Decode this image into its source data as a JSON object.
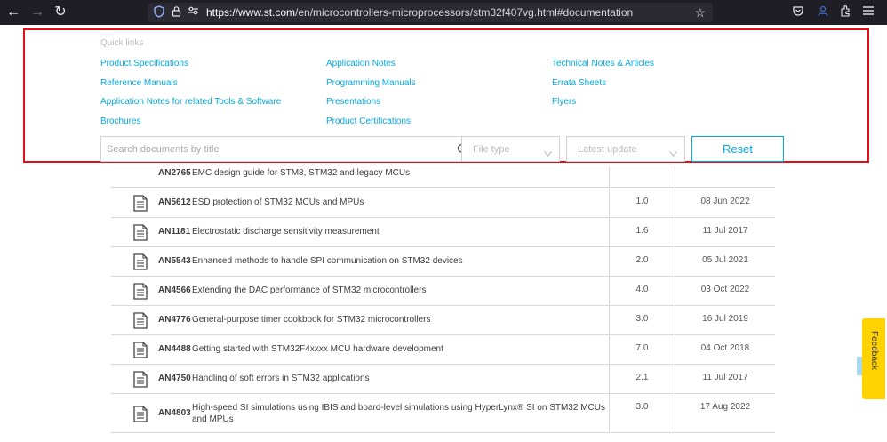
{
  "browser": {
    "url_host": "https://www.st.com",
    "url_path": "/en/microcontrollers-microprocessors/stm32f407vg.html#documentation"
  },
  "quick_links": {
    "heading": "Quick links",
    "col1": [
      "Product Specifications",
      "Reference Manuals",
      "Application Notes for related Tools & Software",
      "Brochures"
    ],
    "col2": [
      "Application Notes",
      "Programming Manuals",
      "Presentations",
      "Product Certifications"
    ],
    "col3": [
      "Technical Notes & Articles",
      "Errata Sheets",
      "Flyers"
    ]
  },
  "filters": {
    "search_placeholder": "Search documents by title",
    "file_type": "File type",
    "latest_update": "Latest update",
    "reset_label": "Reset"
  },
  "partial_row": {
    "code": "AN2765",
    "title": "EMC design guide for STM8, STM32 and legacy MCUs"
  },
  "documents": [
    {
      "code": "AN5612",
      "title": "ESD protection of STM32 MCUs and MPUs",
      "version": "1.0",
      "date": "08 Jun 2022"
    },
    {
      "code": "AN1181",
      "title": "Electrostatic discharge sensitivity measurement",
      "version": "1.6",
      "date": "11 Jul 2017"
    },
    {
      "code": "AN5543",
      "title": "Enhanced methods to handle SPI communication on STM32 devices",
      "version": "2.0",
      "date": "05 Jul 2021"
    },
    {
      "code": "AN4566",
      "title": "Extending the DAC performance of STM32 microcontrollers",
      "version": "4.0",
      "date": "03 Oct 2022"
    },
    {
      "code": "AN4776",
      "title": "General-purpose timer cookbook for STM32 microcontrollers",
      "version": "3.0",
      "date": "16 Jul 2019"
    },
    {
      "code": "AN4488",
      "title": "Getting started with STM32F4xxxx MCU hardware development",
      "version": "7.0",
      "date": "04 Oct 2018"
    },
    {
      "code": "AN4750",
      "title": "Handling of soft errors in STM32 applications",
      "version": "2.1",
      "date": "11 Jul 2017"
    },
    {
      "code": "AN4803",
      "title": "High-speed SI simulations using IBIS and board-level simulations using HyperLynx® SI on STM32 MCUs and MPUs",
      "version": "3.0",
      "date": "17 Aug 2022"
    }
  ],
  "feedback_label": "Feedback",
  "colors": {
    "accent": "#03a9e0",
    "highlight_border": "#e0101a",
    "feedback_tab": "#ffd200"
  }
}
